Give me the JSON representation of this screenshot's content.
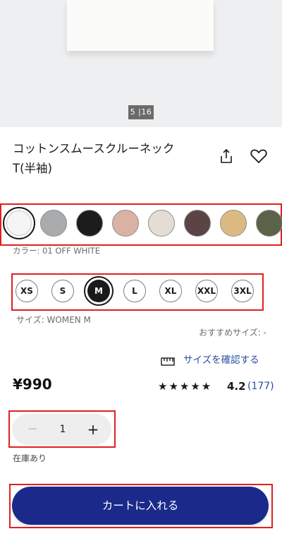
{
  "gallery": {
    "counter": "5 |16"
  },
  "product": {
    "title_line1": "コットンスムースクルーネック",
    "title_line2": "T(半袖)",
    "price": "¥990",
    "rating_stars": "★★★★★",
    "rating_score": "4.2",
    "review_count": "(177)"
  },
  "colors": {
    "label": "カラー: 01 OFF WHITE",
    "swatches": [
      "#f5f5f3",
      "#a9abad",
      "#1c1c1c",
      "#d9b2a3",
      "#e4ddd4",
      "#5b4346",
      "#ddb982",
      "#5a6247"
    ]
  },
  "sizes": {
    "options": [
      "XS",
      "S",
      "M",
      "L",
      "XL",
      "XXL",
      "3XL"
    ],
    "selected": "M",
    "label": "サイズ: WOMEN M",
    "recommended": "おすすめサイズ: -",
    "check_link": "サイズを確認する"
  },
  "quantity": {
    "minus": "−",
    "value": "1",
    "plus": "+"
  },
  "stock": "在庫あり",
  "cart_button": "カートに入れる",
  "accent": {
    "primary": "#1b2a8a",
    "link": "#2b4fa0",
    "highlight": "#e02020"
  }
}
